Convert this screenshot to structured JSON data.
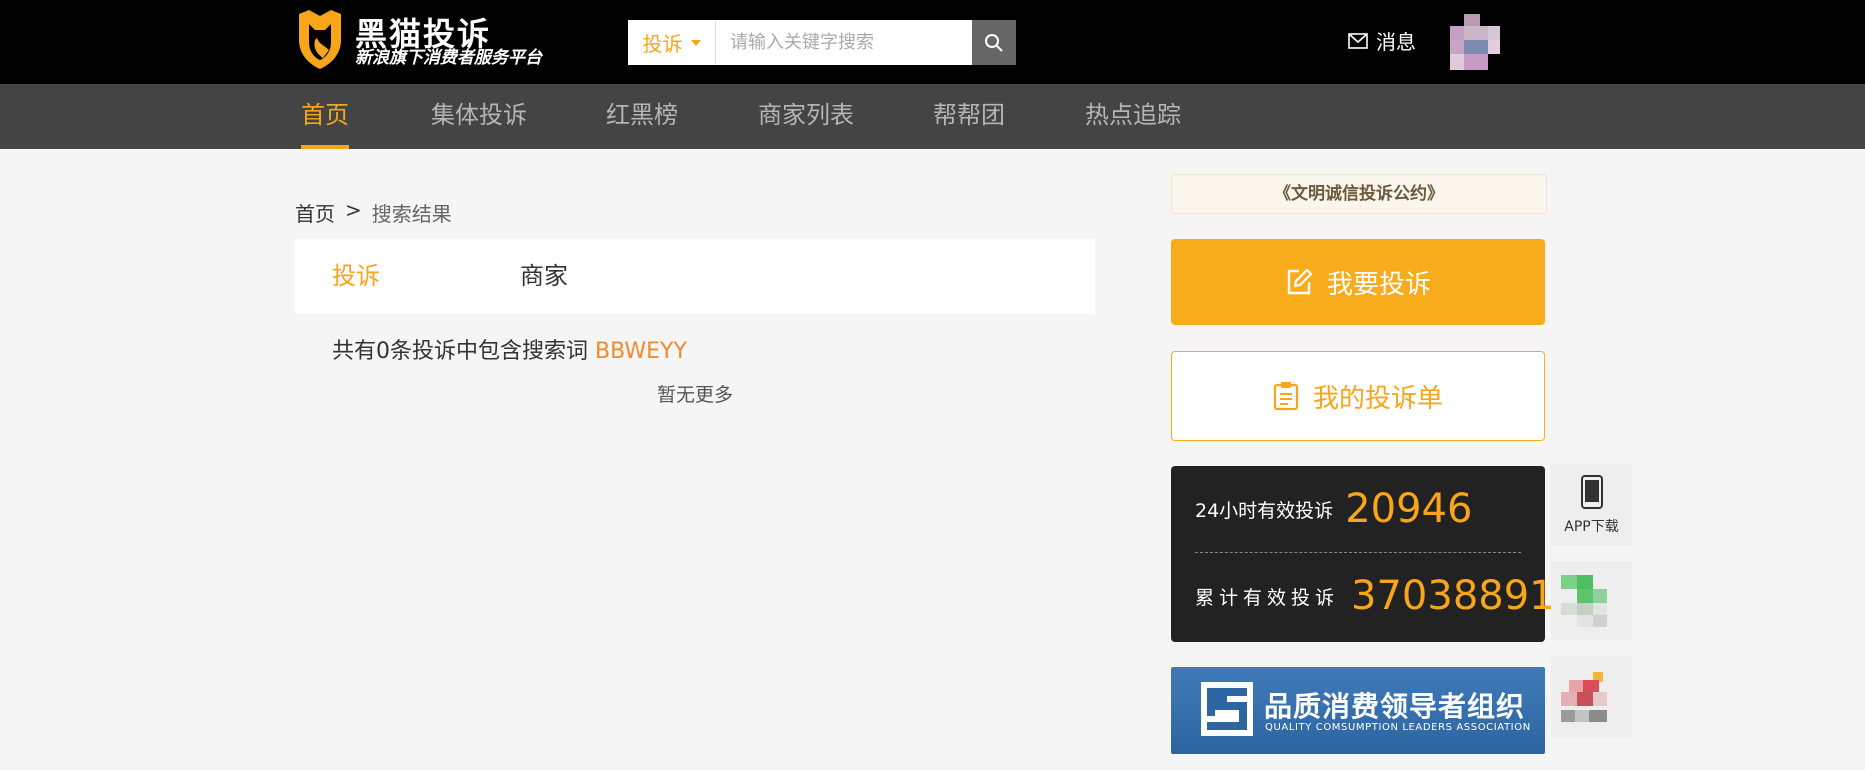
{
  "header": {
    "brand_title": "黑猫投诉",
    "brand_subtitle": "新浪旗下消费者服务平台",
    "search": {
      "type_label": "投诉",
      "placeholder": "请输入关键字搜索"
    },
    "message_label": "消息"
  },
  "nav": {
    "items": [
      {
        "label": "首页",
        "active": true
      },
      {
        "label": "集体投诉"
      },
      {
        "label": "红黑榜"
      },
      {
        "label": "商家列表"
      },
      {
        "label": "帮帮团"
      },
      {
        "label": "热点追踪"
      }
    ]
  },
  "breadcrumb": {
    "home": "首页",
    "separator": ">",
    "current": "搜索结果"
  },
  "tabs": [
    {
      "label": "投诉",
      "active": true
    },
    {
      "label": "商家"
    }
  ],
  "result": {
    "prefix": "共有0条投诉中包含搜索词",
    "keyword": "BBWEYY",
    "no_more": "暂无更多"
  },
  "sidebar": {
    "pact_link": "《文明诚信投诉公约》",
    "complain_button": "我要投诉",
    "my_complaints_button": "我的投诉单",
    "stats": {
      "row1_label": "24小时有效投诉",
      "row1_value": "20946",
      "row2_label": "累计有效投诉",
      "row2_value": "37038891"
    },
    "quality_banner": {
      "title": "品质消费领导者组织",
      "subtitle": "QUALITY COMSUMPTION LEADERS ASSOCIATION"
    },
    "app_download": "APP下载"
  },
  "colors": {
    "accent": "#f8a51c",
    "header_bg": "#000000",
    "nav_bg": "#444444",
    "keyword": "#f08a2e",
    "banner_blue": "#2d64a2"
  }
}
